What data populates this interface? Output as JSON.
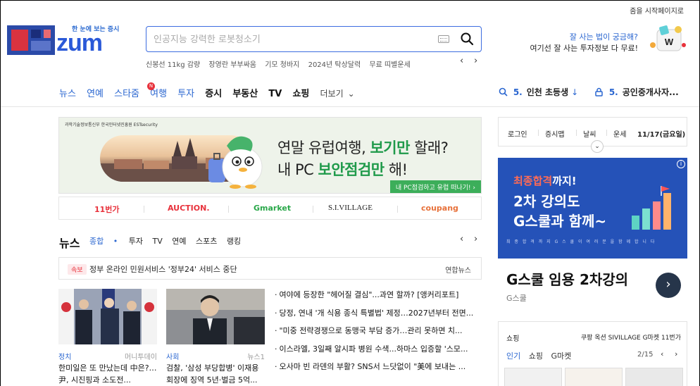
{
  "top_util": {
    "start_page": "줌을 시작페이지로"
  },
  "logo": {
    "tagline": "한 눈에 보는 증시",
    "word": "zum"
  },
  "search": {
    "placeholder": "인공지능 강력한 로봇청소기"
  },
  "trending": [
    "신봉선 11kg 감량",
    "장영란 부부싸움",
    "기모 청바지",
    "2024년 탁상달력",
    "무료 띠별운세"
  ],
  "promo": {
    "line1": "잘 사는 법이 궁금해?",
    "line2": "여기선 잘 사는 투자정보 다 무료!"
  },
  "nav": {
    "items": [
      "뉴스",
      "연예",
      "스타줌",
      "여행",
      "투자",
      "증시",
      "부동산",
      "TV",
      "쇼핑"
    ],
    "badge": "N",
    "more": "더보기"
  },
  "ranking": [
    {
      "num": "5.",
      "text": "인천 초등생"
    },
    {
      "num": "5.",
      "text": "공인중개사자..."
    }
  ],
  "banner": {
    "logos": "과학기술정보통신부   한국인터넷진흥원   ESTsecurity",
    "line1_a": "연말 유럽여행, ",
    "line1_b": "보기만",
    "line1_c": " 할래?",
    "line2_a": "내 PC ",
    "line2_b": "보안점검만",
    "line2_c": " 해!",
    "cta": "내 PC점검하고 유럽 떠나기! ›"
  },
  "shops": [
    "11번가",
    "AUCTION.",
    "Gmarket",
    "S.I.VILLAGE",
    "coupang"
  ],
  "news": {
    "title": "뉴스",
    "tabs": [
      "종합",
      "•",
      "투자",
      "TV",
      "연예",
      "스포츠",
      "랭킹"
    ],
    "breaking_tag": "속보",
    "breaking_text": "정부 온라인 민원서비스 '정부24' 서비스 중단",
    "breaking_src": "연합뉴스",
    "cards": [
      {
        "cat": "정치",
        "src": "머니투데이",
        "title": "한미일은 또 만났는데 中은?…尹, 시진핑과 소도전..."
      },
      {
        "cat": "사회",
        "src": "뉴스1",
        "title": "검찰, '삼성 부당합병' 이재용 회장에 징역 5년·벌금 5억..."
      }
    ],
    "headlines": [
      "여야에 등장한 \"헤어질 결심\"...과연 할까? [앵커리포트]",
      "당정, 연내 '개 식용 종식 특별법' 제정…2027년부터 전면...",
      "\"미중 전략경쟁으로 동맹국 부담 증가…관리 못하면 치...",
      "이스라엘, 3일째 알시파 병원 수색...하마스 입증할 '스모...",
      "오사마 빈 라덴의 부활? SNS서 느닷없이 \"美에 보내는 ..."
    ]
  },
  "login_bar": {
    "items": [
      "로그인",
      "증시맵",
      "날씨",
      "운세"
    ],
    "date": "11/17(금요일)"
  },
  "ad": {
    "h1_red": "최종합격",
    "h1_rest": "까지!",
    "h2_l1": "2차 강의도",
    "h2_l2": "G스쿨과 함께~",
    "fine": "최 종 합 격 까 지 G 스 쿨 이 여 러 분 을 함 께 합 니 다",
    "caption": "G스쿨 임용 2차강의",
    "advertiser": "G스쿨",
    "go": "›",
    "info": "i"
  },
  "shopping": {
    "label": "쇼핑",
    "ticker": "쿠팡 옥션 SIVILLAGE G마켓 11번가",
    "tabs": [
      "인기",
      "쇼핑",
      "G마켓"
    ],
    "page": "2/15"
  },
  "colors": {
    "accent": "#2a66d0",
    "brand_blue": "#2a59d8",
    "red": "#e8323c",
    "green": "#3cae5a",
    "ad_bg": "#2552b8"
  }
}
